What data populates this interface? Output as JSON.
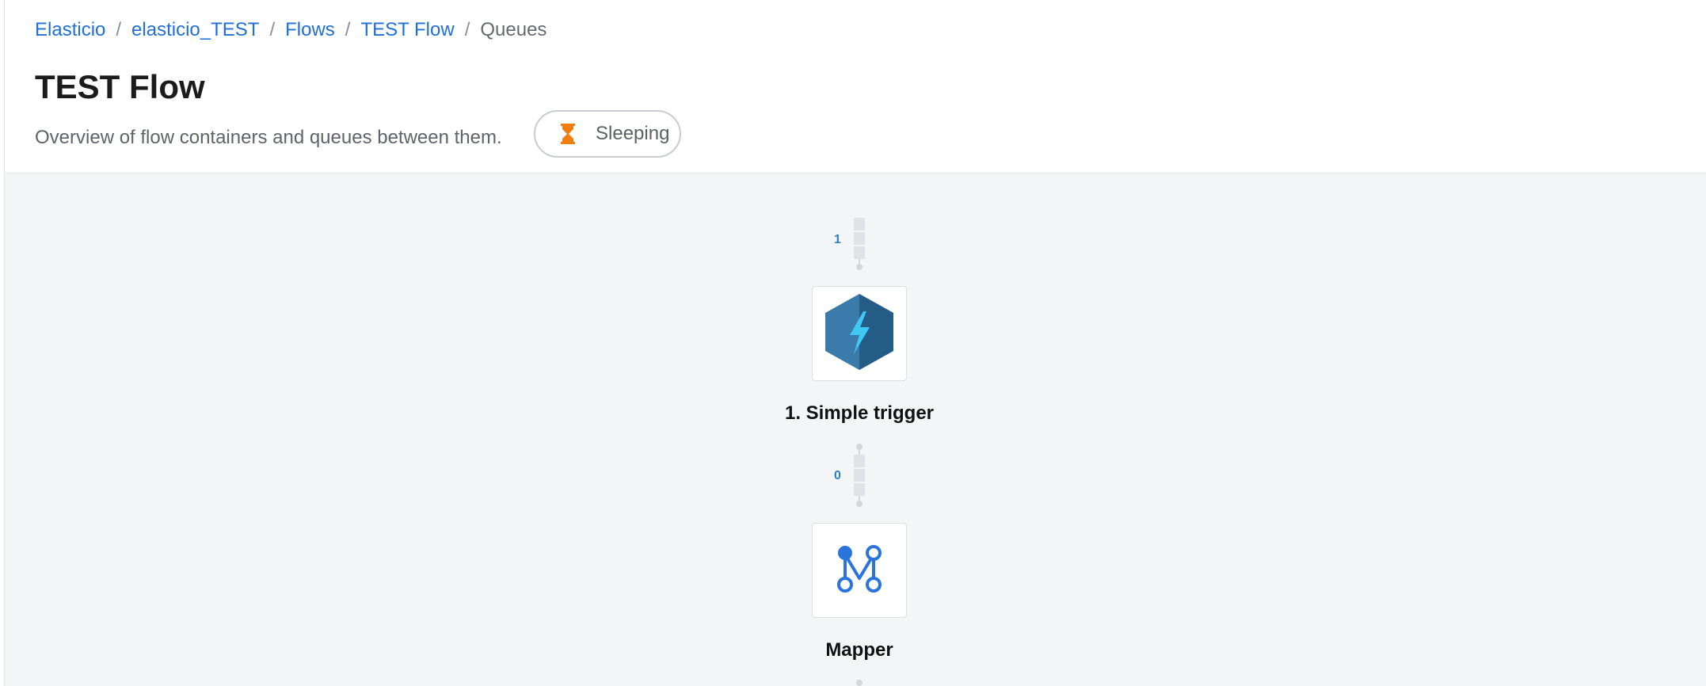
{
  "breadcrumb": {
    "items": [
      {
        "label": "Elasticio"
      },
      {
        "label": "elasticio_TEST"
      },
      {
        "label": "Flows"
      },
      {
        "label": "TEST Flow"
      }
    ],
    "current": "Queues",
    "separator": "/"
  },
  "page": {
    "title": "TEST Flow",
    "subtitle": "Overview of flow containers and queues between them."
  },
  "status": {
    "label": "Sleeping",
    "icon": "hourglass-icon",
    "icon_color": "#f07d12"
  },
  "flow": {
    "queues": [
      {
        "count": "1"
      },
      {
        "count": "0"
      }
    ],
    "steps": [
      {
        "label": "1. Simple trigger",
        "icon": "lightning-hexagon-icon",
        "icon_color": "#2d6d9a",
        "bolt_color": "#3fc8f4"
      },
      {
        "label": "Mapper",
        "icon": "mapper-icon",
        "icon_color": "#2a74dd"
      }
    ]
  },
  "colors": {
    "link": "#1f6fd6",
    "canvas_bg": "#f4f5f7",
    "queue_count": "#2a7fc6"
  }
}
